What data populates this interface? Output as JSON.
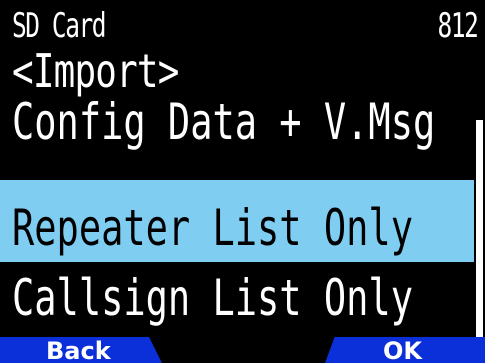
{
  "status": {
    "title": "SD Card",
    "menu_number": "812"
  },
  "menu": {
    "header": "<Import>",
    "items": [
      {
        "label": "Config Data + V.Msg",
        "selected": false
      },
      {
        "label": "Repeater List Only",
        "selected": true
      },
      {
        "label": "Callsign List Only",
        "selected": false
      }
    ]
  },
  "softkeys": {
    "left": "Back",
    "right": "OK"
  },
  "colors": {
    "background": "#000000",
    "text": "#ffffff",
    "highlight": "#7fcdf1",
    "softkey": "#0b2fd9"
  }
}
